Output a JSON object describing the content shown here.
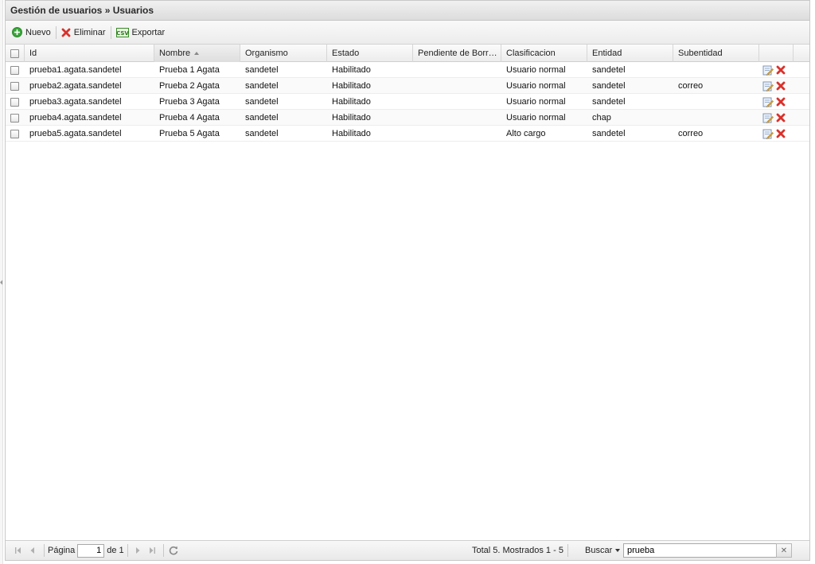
{
  "header": {
    "title": "Gestión de usuarios » Usuarios"
  },
  "toolbar": {
    "new_label": "Nuevo",
    "delete_label": "Eliminar",
    "export_label": "Exportar",
    "export_icon_text": "CSV"
  },
  "grid": {
    "columns": [
      "Id",
      "Nombre",
      "Organismo",
      "Estado",
      "Pendiente de Borr…",
      "Clasificacion",
      "Entidad",
      "Subentidad"
    ],
    "sorted_column": "Nombre",
    "rows": [
      {
        "id": "prueba1.agata.sandetel",
        "nombre": "Prueba 1 Agata",
        "organismo": "sandetel",
        "estado": "Habilitado",
        "pendiente": "",
        "clasificacion": "Usuario normal",
        "entidad": "sandetel",
        "subentidad": ""
      },
      {
        "id": "prueba2.agata.sandetel",
        "nombre": "Prueba 2 Agata",
        "organismo": "sandetel",
        "estado": "Habilitado",
        "pendiente": "",
        "clasificacion": "Usuario normal",
        "entidad": "sandetel",
        "subentidad": "correo"
      },
      {
        "id": "prueba3.agata.sandetel",
        "nombre": "Prueba 3 Agata",
        "organismo": "sandetel",
        "estado": "Habilitado",
        "pendiente": "",
        "clasificacion": "Usuario normal",
        "entidad": "sandetel",
        "subentidad": ""
      },
      {
        "id": "prueba4.agata.sandetel",
        "nombre": "Prueba 4 Agata",
        "organismo": "sandetel",
        "estado": "Habilitado",
        "pendiente": "",
        "clasificacion": "Usuario normal",
        "entidad": "chap",
        "subentidad": ""
      },
      {
        "id": "prueba5.agata.sandetel",
        "nombre": "Prueba 5 Agata",
        "organismo": "sandetel",
        "estado": "Habilitado",
        "pendiente": "",
        "clasificacion": "Alto cargo",
        "entidad": "sandetel",
        "subentidad": "correo"
      }
    ]
  },
  "pager": {
    "page_label": "Página",
    "page_value": "1",
    "of_label": "de 1",
    "total_text": "Total 5. Mostrados 1 - 5",
    "search_menu_label": "Buscar",
    "search_value": "prueba",
    "clear_label": "✕"
  },
  "colors": {
    "accent_green": "#3aa53a",
    "delete_red": "#d9312b",
    "header_bg": "#e4e4e4"
  }
}
